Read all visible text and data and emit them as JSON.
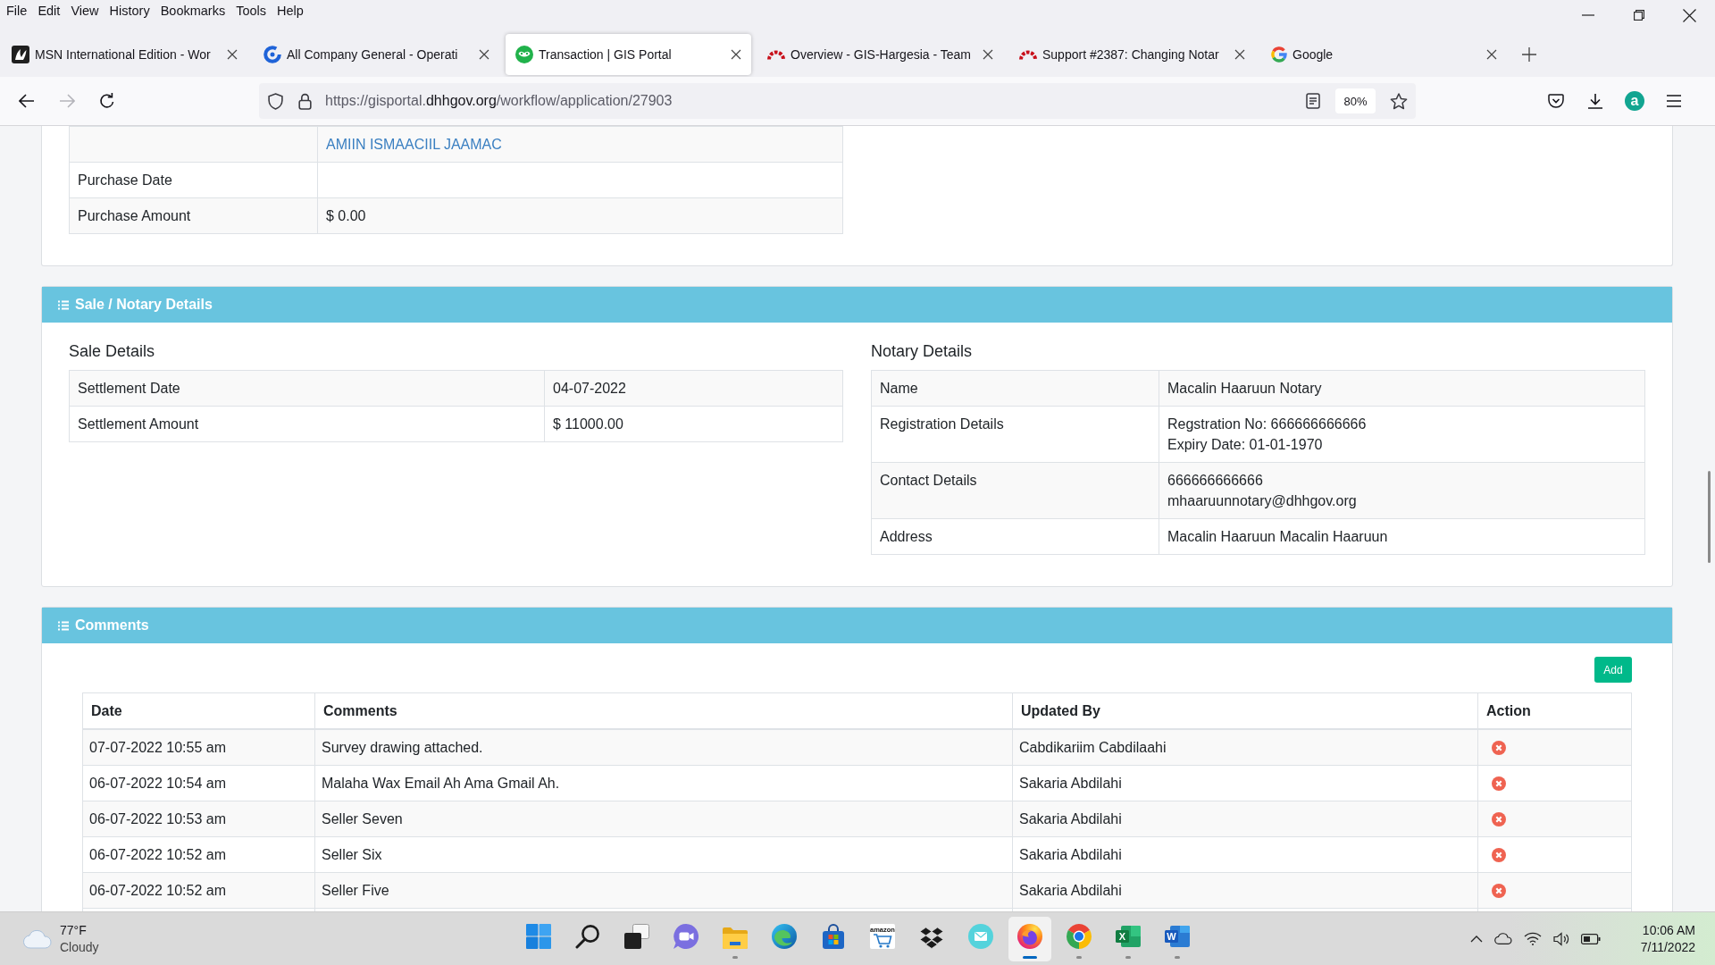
{
  "menu_bar": [
    "File",
    "Edit",
    "View",
    "History",
    "Bookmarks",
    "Tools",
    "Help"
  ],
  "tabs": [
    {
      "kind": "msn",
      "title": "MSN International Edition - Wor",
      "selected": false
    },
    {
      "kind": "ring",
      "title": "All Company General - Operati",
      "selected": false
    },
    {
      "kind": "portal",
      "title": "Transaction | GIS Portal",
      "selected": true
    },
    {
      "kind": "arch",
      "title": "Overview - GIS-Hargesia - Team",
      "selected": false
    },
    {
      "kind": "arch",
      "title": "Support #2387: Changing Notar",
      "selected": false
    },
    {
      "kind": "google",
      "title": "Google",
      "selected": false
    }
  ],
  "navigation": {
    "back_disabled": false,
    "forward_disabled": true
  },
  "address_bar": {
    "url_start": "https://gisportal.",
    "url_domain": "dhhgov.org",
    "url_end": "/workflow/application/27903",
    "zoom": "80%"
  },
  "account_initial": "a",
  "owner_table": {
    "rows": [
      {
        "links": [
          "AMIIN ISMAACIIL JAAMAC"
        ]
      },
      {
        "label": "Purchase Date"
      },
      {
        "label": "Purchase Amount",
        "value": "$ 0.00"
      }
    ]
  },
  "sale_notary": {
    "title": "Sale / Notary Details",
    "sale": {
      "heading": "Sale Details",
      "rows": [
        {
          "label": "Settlement Date",
          "lines": [
            "04-07-2022"
          ]
        },
        {
          "label": "Settlement Amount",
          "lines": [
            "$ 11000.00"
          ]
        }
      ]
    },
    "notary": {
      "heading": "Notary Details",
      "rows": [
        {
          "label": "Name",
          "lines": [
            "Macalin Haaruun Notary"
          ]
        },
        {
          "label": "Registration Details",
          "lines": [
            "Regstration No: 666666666666",
            "Expiry Date: 01-01-1970"
          ]
        },
        {
          "label": "Contact Details",
          "lines": [
            "666666666666",
            "mhaaruunnotary@dhhgov.org"
          ]
        },
        {
          "label": "Address",
          "lines": [
            "Macalin Haaruun Macalin Haaruun"
          ]
        }
      ]
    }
  },
  "comments": {
    "title": "Comments",
    "add_button": "Add",
    "columns": [
      "Date",
      "Comments",
      "Updated By",
      "Action"
    ],
    "rows": [
      {
        "date": "07-07-2022 10:55 am",
        "comment": "Survey drawing attached.",
        "updated_by": "Cabdikariim Cabdilaahi"
      },
      {
        "date": "06-07-2022 10:54 am",
        "comment": "Malaha Wax Email Ah Ama Gmail Ah.",
        "updated_by": "Sakaria Abdilahi"
      },
      {
        "date": "06-07-2022 10:53 am",
        "comment": "Seller Seven",
        "updated_by": "Sakaria Abdilahi"
      },
      {
        "date": "06-07-2022 10:52 am",
        "comment": "Seller Six",
        "updated_by": "Sakaria Abdilahi"
      },
      {
        "date": "06-07-2022 10:52 am",
        "comment": "Seller Five",
        "updated_by": "Sakaria Abdilahi"
      }
    ]
  },
  "taskbar": {
    "weather": {
      "temperature": "77°F",
      "condition": "Cloudy"
    },
    "apps": [
      {
        "kind": "start",
        "running": false,
        "selected": false
      },
      {
        "kind": "search",
        "running": false,
        "selected": false
      },
      {
        "kind": "taskview",
        "running": false,
        "selected": false
      },
      {
        "kind": "chat",
        "running": false,
        "selected": false
      },
      {
        "kind": "explorer",
        "running": true,
        "selected": false
      },
      {
        "kind": "edge",
        "running": false,
        "selected": false
      },
      {
        "kind": "store",
        "running": false,
        "selected": false
      },
      {
        "kind": "amazon",
        "glyph": "amazon",
        "running": false,
        "selected": false
      },
      {
        "kind": "dropbox",
        "running": false,
        "selected": false
      },
      {
        "kind": "mail",
        "running": false,
        "selected": false
      },
      {
        "kind": "firefox",
        "running": true,
        "selected": true
      },
      {
        "kind": "chrome",
        "running": true,
        "selected": false
      },
      {
        "kind": "excel",
        "glyph": "X",
        "running": true,
        "selected": false
      },
      {
        "kind": "word",
        "glyph": "W",
        "running": true,
        "selected": false
      }
    ],
    "clock": {
      "time": "10:06 AM",
      "date": "7/11/2022"
    }
  }
}
